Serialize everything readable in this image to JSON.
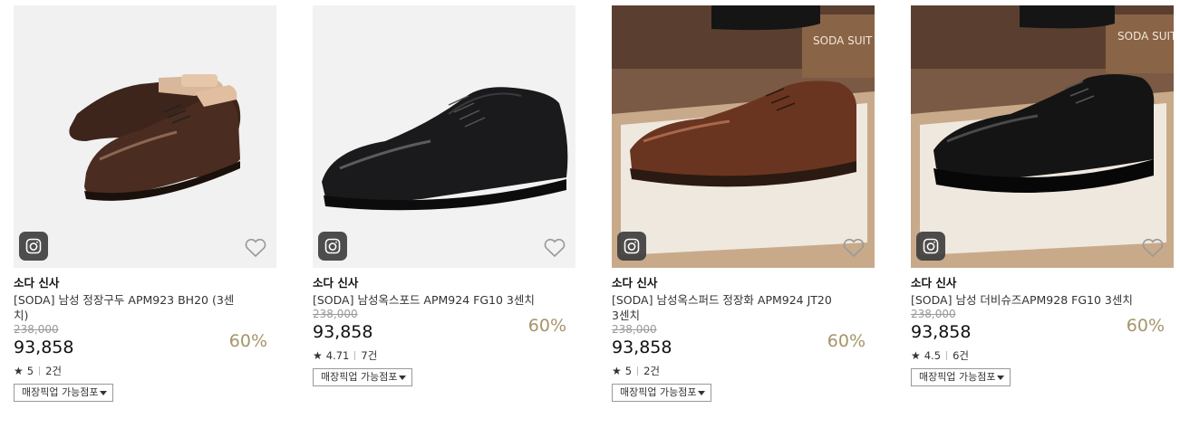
{
  "products": [
    {
      "brand": "소다 신사",
      "title_line1": "[SODA] 남성 정장구두 APM923 BH20 (3센",
      "title_line2": "치)",
      "original_price": "238,000",
      "price": "93,858",
      "discount": "60%",
      "rating_star": "★",
      "rating": "5",
      "reviews": "2건",
      "pickup_label": "매장픽업 가능점포",
      "color": "#4a2e22",
      "background": "#f2f2f2"
    },
    {
      "brand": "소다 신사",
      "title_line1": "[SODA] 남성옥스포드 APM924 FG10 3센치",
      "title_line2": "",
      "original_price": "238,000",
      "price": "93,858",
      "discount": "60%",
      "rating_star": "★",
      "rating": "4.71",
      "reviews": "7건",
      "pickup_label": "매장픽업 가능점포",
      "color": "#1c1c1e",
      "background": "#f2f2f2"
    },
    {
      "brand": "소다 신사",
      "title_line1": "[SODA] 남성옥스퍼드 정장화 APM924 JT20",
      "title_line2": "3센치",
      "original_price": "238,000",
      "price": "93,858",
      "discount": "60%",
      "rating_star": "★",
      "rating": "5",
      "reviews": "2건",
      "pickup_label": "매장픽업 가능점포",
      "color": "#6b3620",
      "background": "#6b4a37",
      "sign_text": "SODA SUIT"
    },
    {
      "brand": "소다 신사",
      "title_line1": "[SODA] 남성 더비슈즈APM928 FG10 3센치",
      "title_line2": "",
      "original_price": "238,000",
      "price": "93,858",
      "discount": "60%",
      "rating_star": "★",
      "rating": "4.5",
      "reviews": "6건",
      "pickup_label": "매장픽업 가능점포",
      "color": "#151515",
      "background": "#6b4a37",
      "sign_text": "SODA SUIT"
    }
  ],
  "icons": {
    "camera": "camera-icon",
    "wishlist": "heart-outline-icon",
    "dropdown": "caret-down-icon"
  }
}
